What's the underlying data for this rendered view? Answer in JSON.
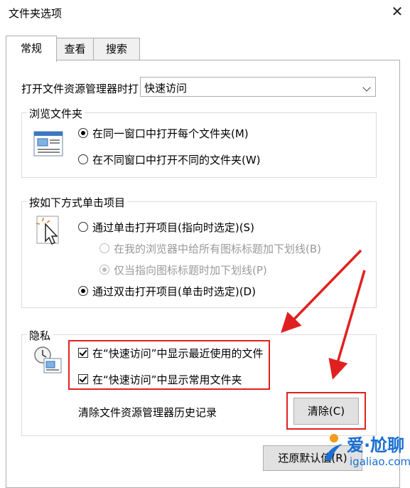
{
  "window": {
    "title": "文件夹选项",
    "close_glyph": "✕"
  },
  "tabs": [
    {
      "label": "常规",
      "active": true
    },
    {
      "label": "查看",
      "active": false
    },
    {
      "label": "搜索",
      "active": false
    }
  ],
  "open_explorer": {
    "label": "打开文件资源管理器时打",
    "value": "快速访问"
  },
  "browse": {
    "legend": "浏览文件夹",
    "options": [
      {
        "label": "在同一窗口中打开每个文件夹(M)",
        "checked": true
      },
      {
        "label": "在不同窗口中打开不同的文件夹(W)",
        "checked": false
      }
    ]
  },
  "click": {
    "legend": "按如下方式单击项目",
    "single": "通过单击打开项目(指向时选定)(S)",
    "underline_all": "在我的浏览器中给所有图标标题加下划线(B)",
    "underline_hover": "仅当指向图标标题时加下划线(P)",
    "double": "通过双击打开项目(单击时选定)(D)"
  },
  "privacy": {
    "legend": "隐私",
    "recent_files": "在“快速访问”中显示最近使用的文件",
    "frequent_folders": "在“快速访问”中显示常用文件夹",
    "clear_history_label": "清除文件资源管理器历史记录",
    "clear_button": "清除(C)"
  },
  "restore_button": "还原默认值(R)",
  "watermark": {
    "brand": "爱·尬聊",
    "url": "igaliao.com"
  },
  "colors": {
    "annotation_red": "#e02020",
    "watermark_blue": "#1a6fd1"
  }
}
